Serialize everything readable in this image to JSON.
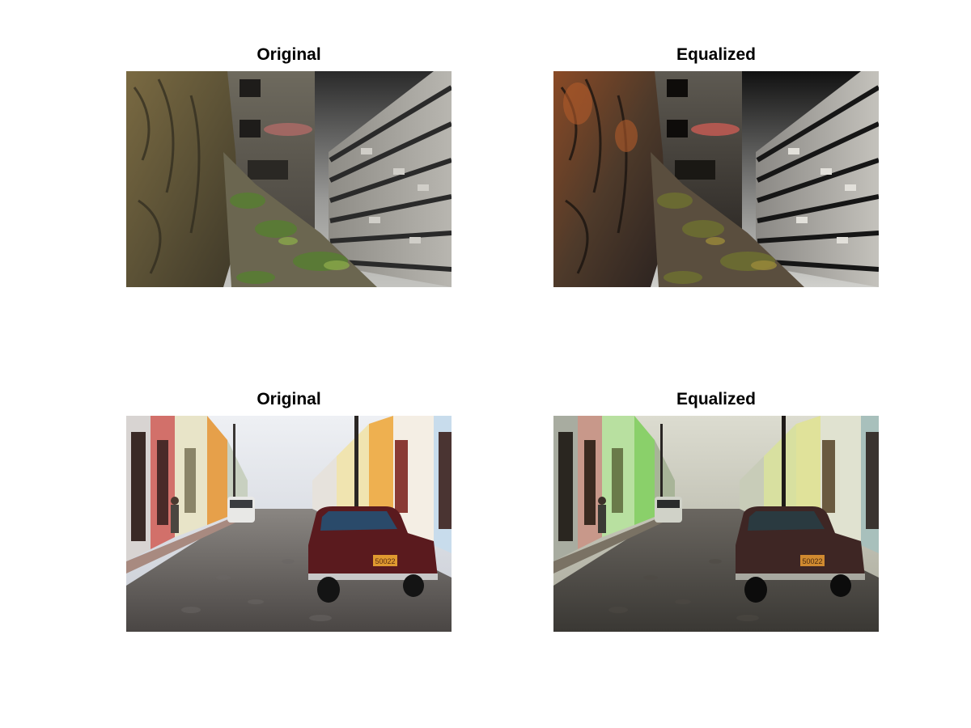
{
  "panels": [
    {
      "title": "Original",
      "scene": "industrial-ruins",
      "variant": "original"
    },
    {
      "title": "Equalized",
      "scene": "industrial-ruins",
      "variant": "equalized"
    },
    {
      "title": "Original",
      "scene": "street-classic-car",
      "variant": "original"
    },
    {
      "title": "Equalized",
      "scene": "street-classic-car",
      "variant": "equalized"
    }
  ],
  "street": {
    "plate_text": "50022"
  },
  "colors": {
    "background": "#ffffff",
    "title_text": "#000000"
  }
}
